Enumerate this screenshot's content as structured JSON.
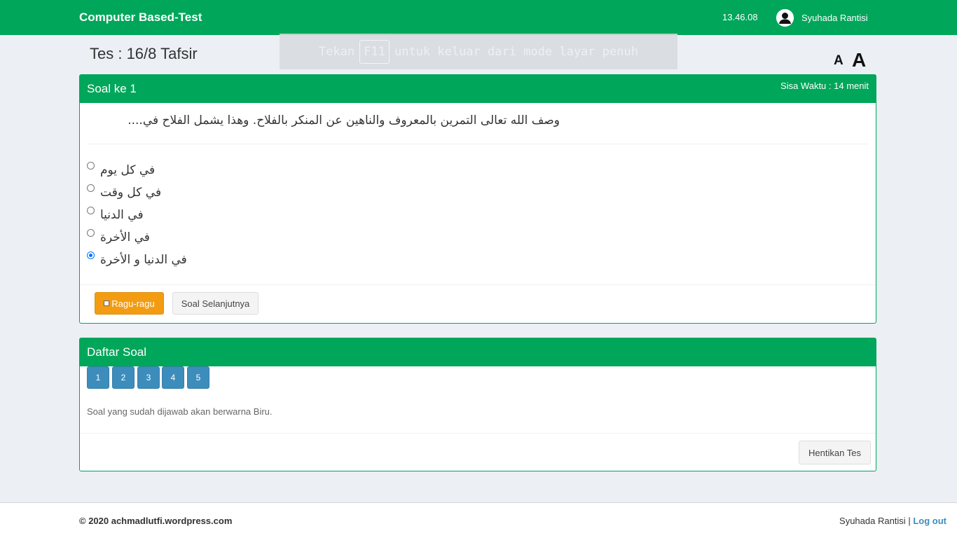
{
  "header": {
    "brand": "Computer Based-Test",
    "clock": "13.46.08",
    "user_name": "Syuhada Rantisi"
  },
  "fullscreen_notice": {
    "before": "Tekan",
    "key": "F11",
    "after": "untuk keluar dari mode layar penuh"
  },
  "page": {
    "title": "Tes : 16/8 Tafsir",
    "font_small_label": "A",
    "font_large_label": "A"
  },
  "question_box": {
    "title": "Soal ke 1",
    "timer": "Sisa Waktu : 14 menit",
    "question_text": "وصف الله تعالى التمرين بالمعروف والناهين عن المنكر بالفلاح. وهذا يشمل الفلاح في....",
    "options": [
      {
        "text": "في كل يوم",
        "selected": false
      },
      {
        "text": "في كل وقت",
        "selected": false
      },
      {
        "text": "في الدنيا",
        "selected": false
      },
      {
        "text": "في الأخرة",
        "selected": false
      },
      {
        "text": "في الدنيا و الأخرة",
        "selected": true
      }
    ],
    "doubt_button": "Ragu-ragu",
    "next_button": "Soal Selanjutnya"
  },
  "list_box": {
    "title": "Daftar Soal",
    "numbers": [
      "1",
      "2",
      "3",
      "4",
      "5"
    ],
    "note": "Soal yang sudah dijawab akan berwarna Biru.",
    "stop_button": "Hentikan Tes"
  },
  "footer": {
    "copyright": "© 2020 achmadlutfi.wordpress.com",
    "user_name": "Syuhada Rantisi",
    "separator": "|",
    "logout": "Log out"
  },
  "colors": {
    "header_green": "#00a65a",
    "warning_orange": "#f39c12",
    "number_blue": "#3c8dbc",
    "background": "#ecf0f5"
  }
}
